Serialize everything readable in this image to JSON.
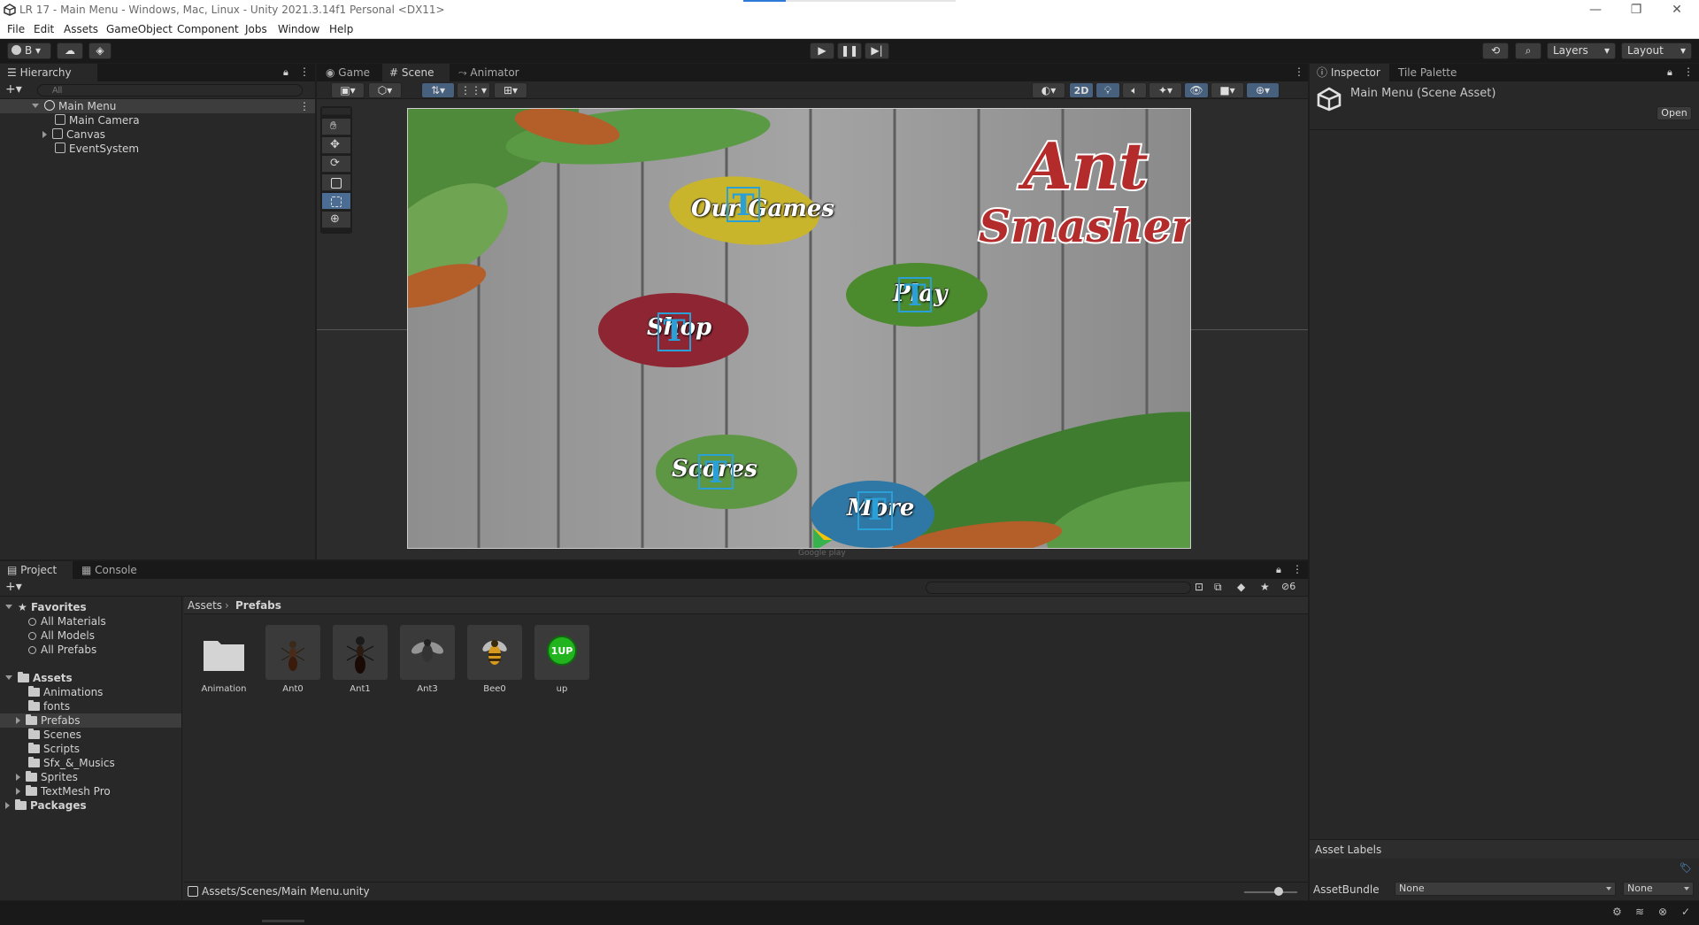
{
  "window": {
    "title": "LR 17 - Main Menu - Windows, Mac, Linux - Unity 2021.3.14f1 Personal <DX11>",
    "minimize": "—",
    "maximize": "❐",
    "close": "✕"
  },
  "menu": [
    "File",
    "Edit",
    "Assets",
    "GameObject",
    "Component",
    "Jobs",
    "Window",
    "Help"
  ],
  "toolbar": {
    "account": "B",
    "layers": "Layers",
    "layout": "Layout"
  },
  "hierarchy": {
    "tab": "Hierarchy",
    "search_placeholder": "All",
    "scene": "Main Menu",
    "children": [
      "Main Camera",
      "Canvas",
      "EventSystem"
    ]
  },
  "scene_tabs": [
    "Game",
    "Scene",
    "Animator"
  ],
  "scene_toolbar": {
    "mode_2d": "2D"
  },
  "game_view": {
    "logo_line1": "Ant",
    "logo_line2": "Smasher",
    "buttons": [
      "Our Games",
      "Shop",
      "Play",
      "Scores",
      "More"
    ],
    "google_play": "Google play"
  },
  "inspector": {
    "tabs": [
      "Inspector",
      "Tile Palette"
    ],
    "asset_title": "Main Menu (Scene Asset)",
    "open_button": "Open",
    "asset_labels": "Asset Labels",
    "asset_bundle_label": "AssetBundle",
    "asset_bundle_value": "None",
    "asset_bundle_variant": "None"
  },
  "project": {
    "tabs": [
      "Project",
      "Console"
    ],
    "favorites_title": "Favorites",
    "favorites": [
      "All Materials",
      "All Models",
      "All Prefabs"
    ],
    "assets_title": "Assets",
    "folders": [
      "Animations",
      "fonts",
      "Prefabs",
      "Scenes",
      "Scripts",
      "Sfx_&_Musics",
      "Sprites",
      "TextMesh Pro"
    ],
    "packages": "Packages",
    "breadcrumb": [
      "Assets",
      "Prefabs"
    ],
    "items": [
      "Animation",
      "Ant0",
      "Ant1",
      "Ant3",
      "Bee0",
      "up"
    ],
    "up_badge": "1UP",
    "hidden_count": "6",
    "status_path": "Assets/Scenes/Main Menu.unity"
  }
}
